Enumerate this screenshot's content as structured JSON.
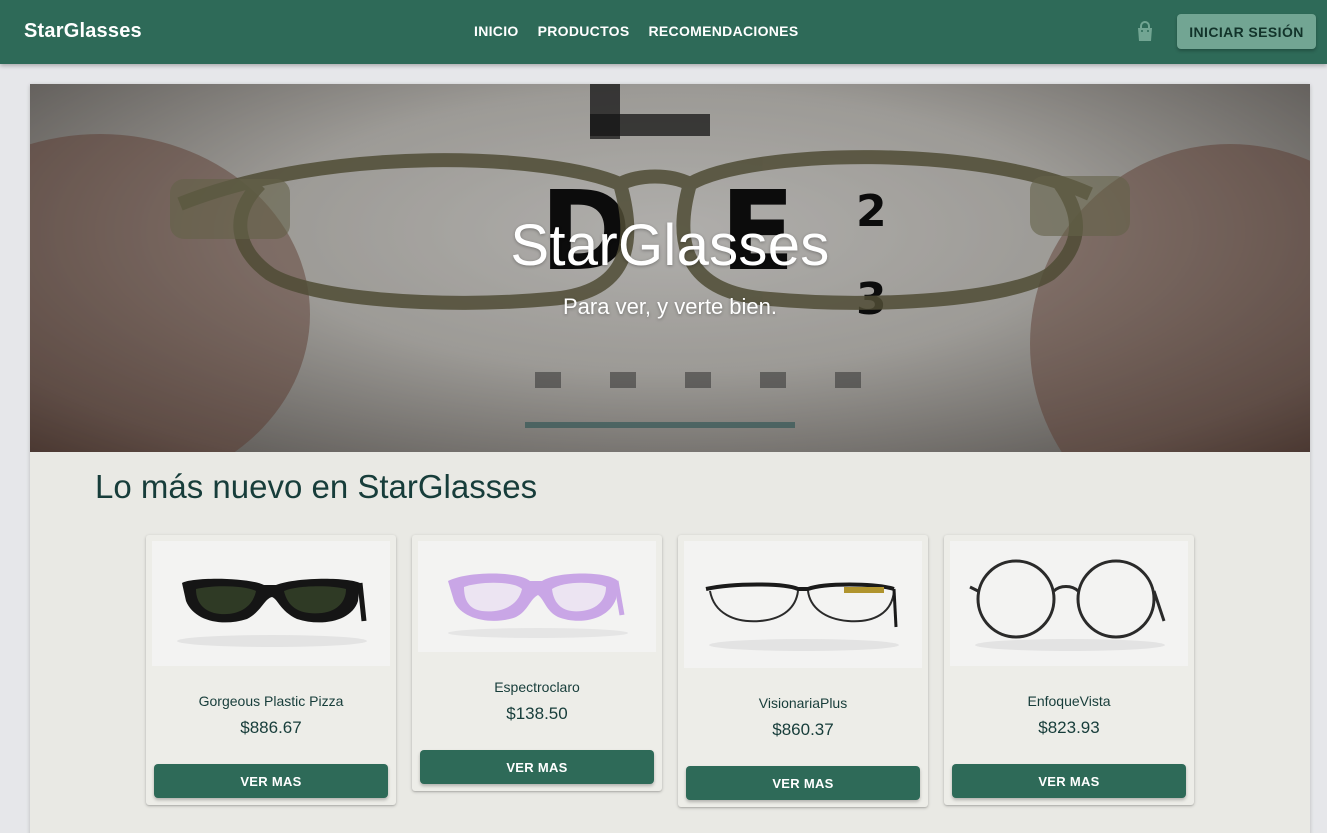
{
  "header": {
    "brand": "StarGlasses",
    "nav": [
      "INICIO",
      "PRODUCTOS",
      "RECOMENDACIONES"
    ],
    "cart_icon": "shopping-bag-icon",
    "login_label": "INICIAR SESIÓN"
  },
  "hero": {
    "title": "StarGlasses",
    "subtitle": "Para ver, y verte bien."
  },
  "section": {
    "title": "Lo más nuevo en StarGlasses"
  },
  "products": [
    {
      "name": "Gorgeous Plastic Pizza",
      "price": "$886.67",
      "button": "VER MAS"
    },
    {
      "name": "Espectroclaro",
      "price": "$138.50",
      "button": "VER MAS"
    },
    {
      "name": "VisionariaPlus",
      "price": "$860.37",
      "button": "VER MAS"
    },
    {
      "name": "EnfoqueVista",
      "price": "$823.93",
      "button": "VER MAS"
    }
  ],
  "colors": {
    "primary": "#2e6a58",
    "login_button": "#72a593",
    "heading_text": "#173d3a",
    "panel_bg": "#e9e9e4"
  }
}
